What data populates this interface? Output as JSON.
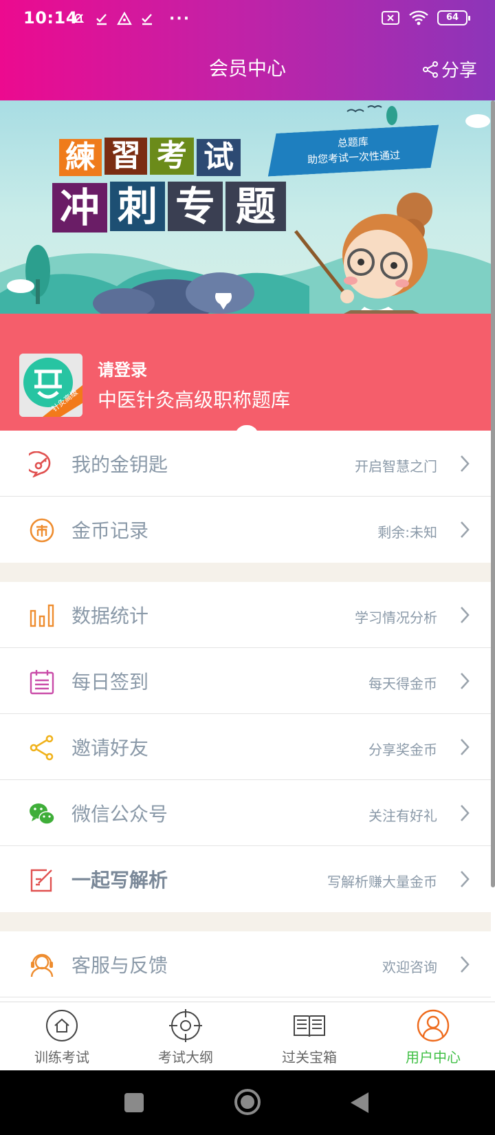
{
  "status": {
    "time": "10:14",
    "more": "···",
    "battery": "64"
  },
  "header": {
    "title": "会员中心",
    "share_label": "分享"
  },
  "banner": {
    "line1": [
      "練",
      "習",
      "考",
      "试"
    ],
    "line2": [
      "冲",
      "刺",
      "专",
      "题"
    ],
    "ribbon_line1": "总题库",
    "ribbon_line2": "助您考试一次性通过"
  },
  "login": {
    "prompt": "请登录",
    "subtitle": "中医针灸高级职称题库",
    "logo_badge": "针灸高级"
  },
  "menu": [
    {
      "icon": "golden-key-icon",
      "label": "我的金钥匙",
      "hint": "开启智慧之门"
    },
    {
      "icon": "coin-icon",
      "label": "金币记录",
      "hint": "剩余:未知"
    },
    {
      "icon": "bar-chart-icon",
      "label": "数据统计",
      "hint": "学习情况分析"
    },
    {
      "icon": "calendar-icon",
      "label": "每日签到",
      "hint": "每天得金币"
    },
    {
      "icon": "share-icon",
      "label": "邀请好友",
      "hint": "分享奖金币"
    },
    {
      "icon": "wechat-icon",
      "label": "微信公众号",
      "hint": "关注有好礼"
    },
    {
      "icon": "edit-icon",
      "label": "一起写解析",
      "hint": "写解析赚大量金币"
    },
    {
      "icon": "customer-service-icon",
      "label": "客服与反馈",
      "hint": "欢迎咨询"
    }
  ],
  "tabs": [
    {
      "icon": "home-icon",
      "label": "训练考试",
      "active": false
    },
    {
      "icon": "target-icon",
      "label": "考试大纲",
      "active": false
    },
    {
      "icon": "book-icon",
      "label": "过关宝箱",
      "active": false
    },
    {
      "icon": "user-icon",
      "label": "用户中心",
      "active": true
    }
  ],
  "colors": {
    "header_start": "#ec0a8f",
    "header_end": "#8d35b9",
    "login_bg": "#f55e6b",
    "active_tab": "#3fbf44"
  }
}
